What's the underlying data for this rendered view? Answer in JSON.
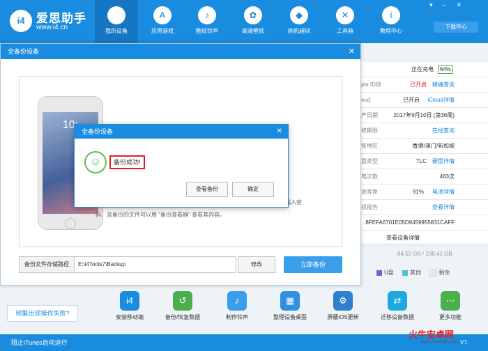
{
  "app": {
    "name": "爱思助手",
    "url": "www.i4.cn",
    "logo_text": "i4"
  },
  "nav": [
    {
      "label": "我的设备",
      "icon": "apple-icon",
      "glyph": ""
    },
    {
      "label": "应用游戏",
      "icon": "app-store-icon",
      "glyph": "A"
    },
    {
      "label": "酷炫铃声",
      "icon": "bell-icon",
      "glyph": "♪"
    },
    {
      "label": "高清壁纸",
      "icon": "flower-icon",
      "glyph": "✿"
    },
    {
      "label": "刷机越狱",
      "icon": "dropbox-icon",
      "glyph": "◆"
    },
    {
      "label": "工具箱",
      "icon": "toolbox-icon",
      "glyph": "✕"
    },
    {
      "label": "教程中心",
      "icon": "info-icon",
      "glyph": "i"
    }
  ],
  "header": {
    "download_center": "下载中心",
    "window_controls": "▾ – ✕"
  },
  "device_panel": {
    "rows": [
      {
        "key": "",
        "value": "正在充电",
        "badge": "64%"
      },
      {
        "key": "ple ID锁",
        "value": "已开启",
        "link": "精确查询"
      },
      {
        "key": "oud",
        "value": "已开启",
        "link": "iCloud详情"
      },
      {
        "key": "产日期",
        "value": "2017年9月10日 (第36周)",
        "link": ""
      },
      {
        "key": "修期限",
        "value": "",
        "link": "在线查询"
      },
      {
        "key": "售地区",
        "value": "香港/澳门/新加坡",
        "link": ""
      },
      {
        "key": "盘类型",
        "value": "TLC",
        "link": "硬盘详情"
      },
      {
        "key": "电次数",
        "value": "483次",
        "link": ""
      },
      {
        "key": "池寿命",
        "value": "91%",
        "link": "电池详情"
      },
      {
        "key": "机报告",
        "value": "",
        "link": "查看详情"
      },
      {
        "key": "",
        "value": "8FEFA6701E05D9459955831CAFF",
        "link": ""
      },
      {
        "key": "",
        "value": "查看设备详情",
        "link": ""
      }
    ],
    "disk_usage": "84.52 GB / 238.41 GB",
    "legend": [
      {
        "label": "U盘",
        "color": "#7b5cd6"
      },
      {
        "label": "其他",
        "color": "#4ec0d6"
      },
      {
        "label": "剩余",
        "color": "#e8e8e8"
      }
    ]
  },
  "backup_dialog": {
    "title": "全备份设备",
    "close": "✕",
    "phone_time": "10:",
    "note_right": "过无需输入密",
    "note_bottom": "码，且备份的文件可以用 \"备份查看器\" 查看其内容。",
    "path_label": "备份文件存储路径",
    "path_value": "E:\\i4Tools7\\Backup",
    "modify_label": "修改",
    "backup_now_label": "立即备份"
  },
  "success_dialog": {
    "title": "全备份设备",
    "close": "✕",
    "message": "备份成功!",
    "view_label": "查看备份",
    "ok_label": "确定"
  },
  "tools": [
    {
      "label": "安装移动端",
      "icon": "i4-icon",
      "color": "#1a8ce0",
      "glyph": "i4"
    },
    {
      "label": "备份/恢复数据",
      "icon": "clock-icon",
      "color": "#4cae4c",
      "glyph": "↺"
    },
    {
      "label": "制作铃声",
      "icon": "bell-plus-icon",
      "color": "#3b9eea",
      "glyph": "♪"
    },
    {
      "label": "整理设备桌面",
      "icon": "grid-icon",
      "color": "#2f8fe0",
      "glyph": "▦"
    },
    {
      "label": "屏蔽iOS更新",
      "icon": "gear-icon",
      "color": "#2f7fd0",
      "glyph": "⚙"
    },
    {
      "label": "迁移设备数据",
      "icon": "transfer-icon",
      "color": "#1fa8e0",
      "glyph": "⇄"
    },
    {
      "label": "更多功能",
      "icon": "more-icon",
      "color": "#4cae4c",
      "glyph": "⋯"
    }
  ],
  "bottom": {
    "freq_fail": "频繁出现操作失败?",
    "itunes_stop": "阻止iTunes自动运行",
    "version": "V7."
  },
  "watermark": {
    "text": "火牛安卓网",
    "url": "www.hnzzdt.com"
  }
}
